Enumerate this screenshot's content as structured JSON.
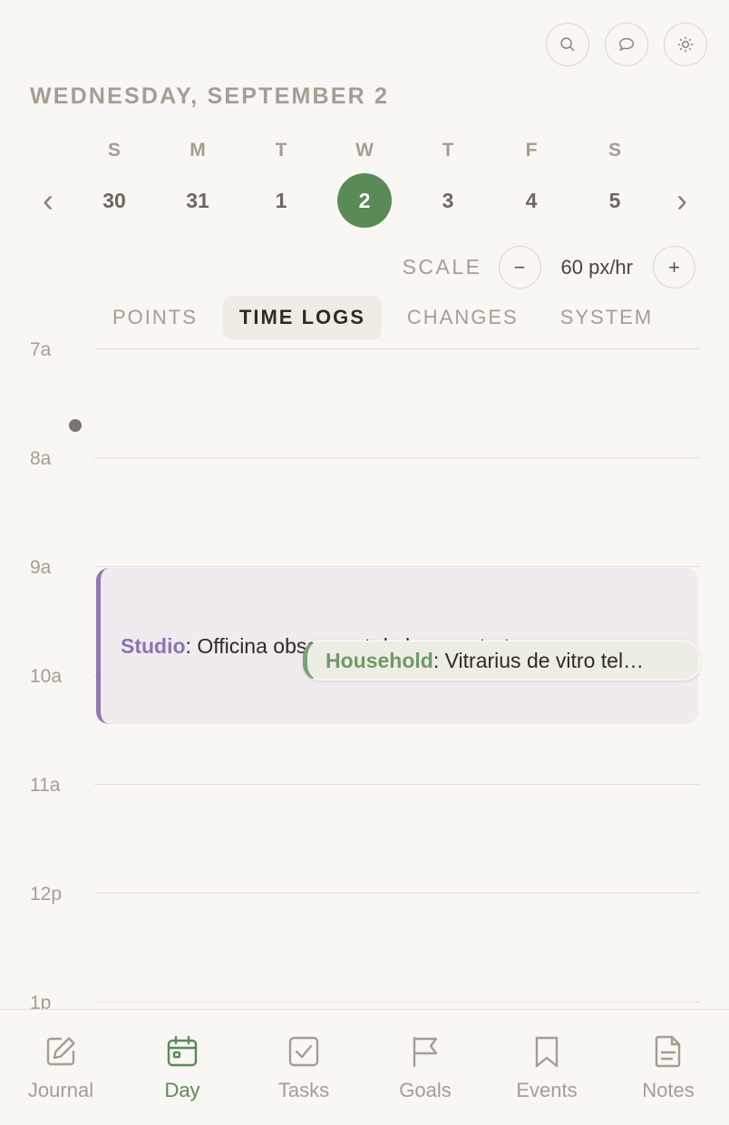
{
  "header": {
    "date": "WEDNESDAY, SEPTEMBER 2",
    "icons": [
      "search-icon",
      "chat-icon",
      "sun-icon"
    ]
  },
  "week": {
    "weekdays": [
      "S",
      "M",
      "T",
      "W",
      "T",
      "F",
      "S"
    ],
    "dates": [
      "30",
      "31",
      "1",
      "2",
      "3",
      "4",
      "5"
    ],
    "selected_index": 3,
    "prev": "‹",
    "next": "›"
  },
  "scale": {
    "label": "SCALE",
    "value": "60 px/hr",
    "minus": "−",
    "plus": "+"
  },
  "tabs": [
    {
      "label": "POINTS",
      "active": false
    },
    {
      "label": "TIME LOGS",
      "active": true
    },
    {
      "label": "CHANGES",
      "active": false
    },
    {
      "label": "SYSTEM",
      "active": false
    }
  ],
  "timeline": {
    "hours": [
      "7a",
      "8a",
      "9a",
      "10a",
      "11a",
      "12p",
      "1p"
    ],
    "entries": [
      {
        "category": "Studio",
        "separator": ": ",
        "text": "Officina obscura et de lucerna tortor",
        "color": "#8f78b4"
      },
      {
        "category": "Household",
        "separator": ": ",
        "text": "Vitrarius de vitro tel…",
        "color": "#7aa274"
      }
    ]
  },
  "nav": [
    {
      "label": "Journal",
      "icon": "journal-edit-icon",
      "active": false
    },
    {
      "label": "Day",
      "icon": "calendar-icon",
      "active": true
    },
    {
      "label": "Tasks",
      "icon": "checkbox-icon",
      "active": false
    },
    {
      "label": "Goals",
      "icon": "flag-icon",
      "active": false
    },
    {
      "label": "Events",
      "icon": "bookmark-icon",
      "active": false
    },
    {
      "label": "Notes",
      "icon": "document-icon",
      "active": false
    }
  ],
  "colors": {
    "accent": "#5a8a56",
    "background": "#f9f7f3",
    "muted": "#a69d92"
  }
}
